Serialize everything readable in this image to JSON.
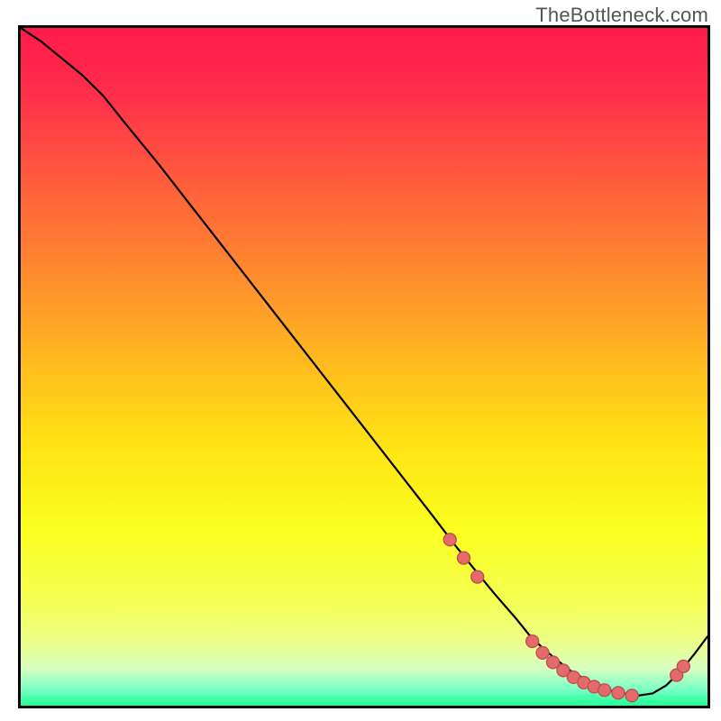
{
  "branding": {
    "watermark": "TheBottleneck.com"
  },
  "chart_data": {
    "type": "line",
    "title": "",
    "xlabel": "",
    "ylabel": "",
    "xlim": [
      0,
      100
    ],
    "ylim": [
      0,
      100
    ],
    "background": {
      "type": "vertical-gradient",
      "stops": [
        {
          "offset": 0.0,
          "color": "#ff1a4b"
        },
        {
          "offset": 0.1,
          "color": "#ff2f4a"
        },
        {
          "offset": 0.22,
          "color": "#ff5a3d"
        },
        {
          "offset": 0.36,
          "color": "#ff8a2e"
        },
        {
          "offset": 0.5,
          "color": "#ffbd1e"
        },
        {
          "offset": 0.62,
          "color": "#ffe414"
        },
        {
          "offset": 0.74,
          "color": "#fbff1f"
        },
        {
          "offset": 0.84,
          "color": "#f4ff4f"
        },
        {
          "offset": 0.905,
          "color": "#ecff87"
        },
        {
          "offset": 0.945,
          "color": "#d8ffc0"
        },
        {
          "offset": 0.975,
          "color": "#7dffc6"
        },
        {
          "offset": 1.0,
          "color": "#1fff93"
        }
      ]
    },
    "curve": {
      "stroke": "#000000",
      "strokeWidth": 2.2,
      "x": [
        0,
        3,
        6,
        9,
        12,
        15,
        20,
        25,
        30,
        35,
        40,
        45,
        50,
        55,
        60,
        63,
        66,
        69,
        72,
        74,
        76,
        78,
        80,
        82,
        84,
        86,
        88,
        90,
        92,
        94,
        96,
        98,
        100
      ],
      "y": [
        100.0,
        98.0,
        95.5,
        93.0,
        90.0,
        86.2,
        80.0,
        73.5,
        67.0,
        60.5,
        54.0,
        47.5,
        41.0,
        34.5,
        28.0,
        24.0,
        20.2,
        16.5,
        13.0,
        10.5,
        8.5,
        6.8,
        5.2,
        4.0,
        3.0,
        2.2,
        1.8,
        1.5,
        1.8,
        3.0,
        5.0,
        7.5,
        10.2
      ]
    },
    "markers": {
      "fill": "#e46b6b",
      "stroke": "#c24f4f",
      "radius": 7,
      "points": [
        {
          "x": 62.5,
          "y": 24.5
        },
        {
          "x": 64.5,
          "y": 21.8
        },
        {
          "x": 66.5,
          "y": 19.0
        },
        {
          "x": 74.5,
          "y": 9.5
        },
        {
          "x": 76.0,
          "y": 7.8
        },
        {
          "x": 77.5,
          "y": 6.4
        },
        {
          "x": 79.0,
          "y": 5.2
        },
        {
          "x": 80.5,
          "y": 4.2
        },
        {
          "x": 82.0,
          "y": 3.4
        },
        {
          "x": 83.5,
          "y": 2.8
        },
        {
          "x": 85.0,
          "y": 2.3
        },
        {
          "x": 87.0,
          "y": 1.9
        },
        {
          "x": 89.0,
          "y": 1.5
        },
        {
          "x": 95.5,
          "y": 4.5
        },
        {
          "x": 96.5,
          "y": 5.8
        }
      ]
    }
  }
}
